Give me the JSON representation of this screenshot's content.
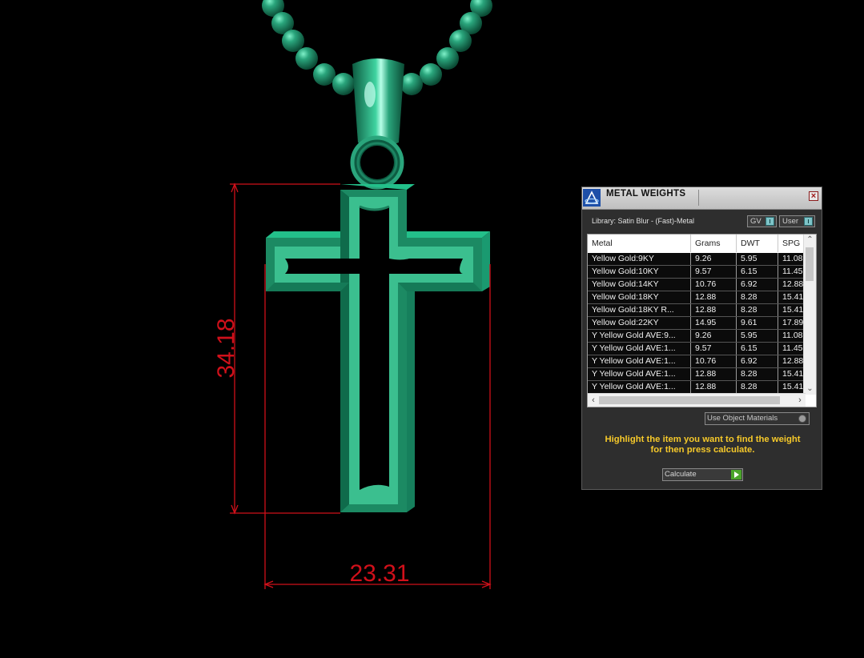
{
  "viewport": {
    "dimensions": {
      "height": "34.18",
      "width": "23.31"
    },
    "colors": {
      "background": "#000000",
      "model": "#2aa57c",
      "dimension": "#d0101a"
    }
  },
  "panel": {
    "title": "METAL WEIGHTS",
    "close_glyph": "×",
    "library_label": "Library: Satin Blur - (Fast)-Metal",
    "gv_label": "GV",
    "user_label": "User",
    "columns": [
      "Metal",
      "Grams",
      "DWT",
      "SPG"
    ],
    "rows": [
      [
        "Yellow Gold:9KY",
        "9.26",
        "5.95",
        "11.08"
      ],
      [
        "Yellow Gold:10KY",
        "9.57",
        "6.15",
        "11.45"
      ],
      [
        "Yellow Gold:14KY",
        "10.76",
        "6.92",
        "12.88"
      ],
      [
        "Yellow Gold:18KY",
        "12.88",
        "8.28",
        "15.41"
      ],
      [
        "Yellow Gold:18KY R...",
        "12.88",
        "8.28",
        "15.41"
      ],
      [
        "Yellow Gold:22KY",
        "14.95",
        "9.61",
        "17.89"
      ],
      [
        "Y Yellow Gold AVE:9...",
        "9.26",
        "5.95",
        "11.08"
      ],
      [
        "Y Yellow Gold AVE:1...",
        "9.57",
        "6.15",
        "11.45"
      ],
      [
        "Y Yellow Gold AVE:1...",
        "10.76",
        "6.92",
        "12.88"
      ],
      [
        "Y Yellow Gold AVE:1...",
        "12.88",
        "8.28",
        "15.41"
      ],
      [
        "Y Yellow Gold AVE:1...",
        "12.88",
        "8.28",
        "15.41"
      ]
    ],
    "use_object_materials_label": "Use Object Materials",
    "hint_line1": "Highlight the item you want to find the weight",
    "hint_line2": "for then press calculate.",
    "calculate_label": "Calculate",
    "colors": {
      "hint": "#f6c92a",
      "calculate_go": "#4aa52a"
    }
  }
}
